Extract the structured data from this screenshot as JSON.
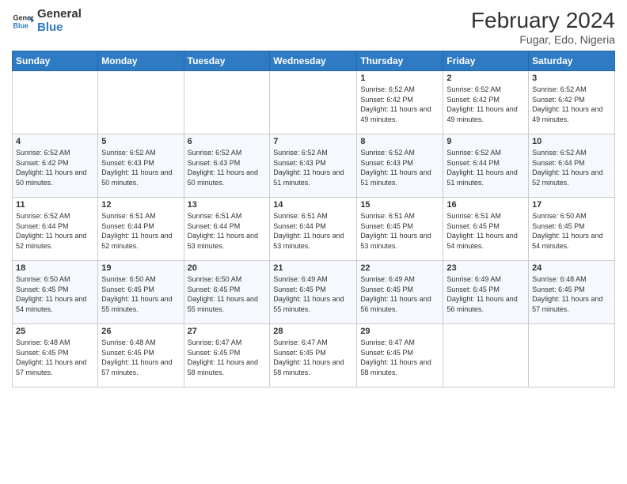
{
  "logo": {
    "line1": "General",
    "line2": "Blue"
  },
  "title": {
    "month_year": "February 2024",
    "location": "Fugar, Edo, Nigeria"
  },
  "weekdays": [
    "Sunday",
    "Monday",
    "Tuesday",
    "Wednesday",
    "Thursday",
    "Friday",
    "Saturday"
  ],
  "weeks": [
    [
      {
        "day": "",
        "info": ""
      },
      {
        "day": "",
        "info": ""
      },
      {
        "day": "",
        "info": ""
      },
      {
        "day": "",
        "info": ""
      },
      {
        "day": "1",
        "info": "Sunrise: 6:52 AM\nSunset: 6:42 PM\nDaylight: 11 hours and 49 minutes."
      },
      {
        "day": "2",
        "info": "Sunrise: 6:52 AM\nSunset: 6:42 PM\nDaylight: 11 hours and 49 minutes."
      },
      {
        "day": "3",
        "info": "Sunrise: 6:52 AM\nSunset: 6:42 PM\nDaylight: 11 hours and 49 minutes."
      }
    ],
    [
      {
        "day": "4",
        "info": "Sunrise: 6:52 AM\nSunset: 6:42 PM\nDaylight: 11 hours and 50 minutes."
      },
      {
        "day": "5",
        "info": "Sunrise: 6:52 AM\nSunset: 6:43 PM\nDaylight: 11 hours and 50 minutes."
      },
      {
        "day": "6",
        "info": "Sunrise: 6:52 AM\nSunset: 6:43 PM\nDaylight: 11 hours and 50 minutes."
      },
      {
        "day": "7",
        "info": "Sunrise: 6:52 AM\nSunset: 6:43 PM\nDaylight: 11 hours and 51 minutes."
      },
      {
        "day": "8",
        "info": "Sunrise: 6:52 AM\nSunset: 6:43 PM\nDaylight: 11 hours and 51 minutes."
      },
      {
        "day": "9",
        "info": "Sunrise: 6:52 AM\nSunset: 6:44 PM\nDaylight: 11 hours and 51 minutes."
      },
      {
        "day": "10",
        "info": "Sunrise: 6:52 AM\nSunset: 6:44 PM\nDaylight: 11 hours and 52 minutes."
      }
    ],
    [
      {
        "day": "11",
        "info": "Sunrise: 6:52 AM\nSunset: 6:44 PM\nDaylight: 11 hours and 52 minutes."
      },
      {
        "day": "12",
        "info": "Sunrise: 6:51 AM\nSunset: 6:44 PM\nDaylight: 11 hours and 52 minutes."
      },
      {
        "day": "13",
        "info": "Sunrise: 6:51 AM\nSunset: 6:44 PM\nDaylight: 11 hours and 53 minutes."
      },
      {
        "day": "14",
        "info": "Sunrise: 6:51 AM\nSunset: 6:44 PM\nDaylight: 11 hours and 53 minutes."
      },
      {
        "day": "15",
        "info": "Sunrise: 6:51 AM\nSunset: 6:45 PM\nDaylight: 11 hours and 53 minutes."
      },
      {
        "day": "16",
        "info": "Sunrise: 6:51 AM\nSunset: 6:45 PM\nDaylight: 11 hours and 54 minutes."
      },
      {
        "day": "17",
        "info": "Sunrise: 6:50 AM\nSunset: 6:45 PM\nDaylight: 11 hours and 54 minutes."
      }
    ],
    [
      {
        "day": "18",
        "info": "Sunrise: 6:50 AM\nSunset: 6:45 PM\nDaylight: 11 hours and 54 minutes."
      },
      {
        "day": "19",
        "info": "Sunrise: 6:50 AM\nSunset: 6:45 PM\nDaylight: 11 hours and 55 minutes."
      },
      {
        "day": "20",
        "info": "Sunrise: 6:50 AM\nSunset: 6:45 PM\nDaylight: 11 hours and 55 minutes."
      },
      {
        "day": "21",
        "info": "Sunrise: 6:49 AM\nSunset: 6:45 PM\nDaylight: 11 hours and 55 minutes."
      },
      {
        "day": "22",
        "info": "Sunrise: 6:49 AM\nSunset: 6:45 PM\nDaylight: 11 hours and 56 minutes."
      },
      {
        "day": "23",
        "info": "Sunrise: 6:49 AM\nSunset: 6:45 PM\nDaylight: 11 hours and 56 minutes."
      },
      {
        "day": "24",
        "info": "Sunrise: 6:48 AM\nSunset: 6:45 PM\nDaylight: 11 hours and 57 minutes."
      }
    ],
    [
      {
        "day": "25",
        "info": "Sunrise: 6:48 AM\nSunset: 6:45 PM\nDaylight: 11 hours and 57 minutes."
      },
      {
        "day": "26",
        "info": "Sunrise: 6:48 AM\nSunset: 6:45 PM\nDaylight: 11 hours and 57 minutes."
      },
      {
        "day": "27",
        "info": "Sunrise: 6:47 AM\nSunset: 6:45 PM\nDaylight: 11 hours and 58 minutes."
      },
      {
        "day": "28",
        "info": "Sunrise: 6:47 AM\nSunset: 6:45 PM\nDaylight: 11 hours and 58 minutes."
      },
      {
        "day": "29",
        "info": "Sunrise: 6:47 AM\nSunset: 6:45 PM\nDaylight: 11 hours and 58 minutes."
      },
      {
        "day": "",
        "info": ""
      },
      {
        "day": "",
        "info": ""
      }
    ]
  ]
}
